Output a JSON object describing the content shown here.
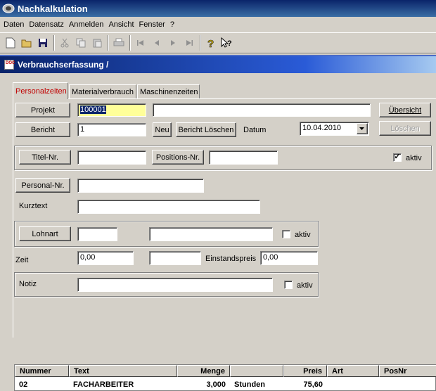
{
  "window": {
    "title": "Nachkalkulation"
  },
  "menu": {
    "items": [
      "Daten",
      "Datensatz",
      "Anmelden",
      "Ansicht",
      "Fenster",
      "?"
    ]
  },
  "child": {
    "title": "Verbrauchserfassung /"
  },
  "tabs": [
    "Personalzeiten",
    "Materialverbrauch",
    "Maschinenzeiten"
  ],
  "form": {
    "projekt_label": "Projekt",
    "projekt_value": "100001",
    "projekt_name": "",
    "uebersicht_label": "Übersicht",
    "bericht_label": "Bericht",
    "bericht_value": "1",
    "neu_label": "Neu",
    "bericht_loeschen_label": "Bericht Löschen",
    "datum_label": "Datum",
    "datum_value": "10.04.2010",
    "loeschen_label": "Löschen",
    "titel_label": "Titel-Nr.",
    "titel_value": "",
    "positions_label": "Positions-Nr.",
    "positions_value": "",
    "aktiv_label": "aktiv",
    "aktiv1_checked": "✓",
    "personal_label": "Personal-Nr.",
    "personal_value": "",
    "kurztext_label": "Kurztext",
    "kurztext_value": "",
    "lohnart_label": "Lohnart",
    "lohnart_code": "",
    "lohnart_name": "",
    "aktiv2_checked": "",
    "zeit_label": "Zeit",
    "zeit_value": "0,00",
    "zeit_extra": "",
    "einstandspreis_label": "Einstandspreis",
    "einstandspreis_value": "0,00",
    "notiz_label": "Notiz",
    "notiz_value": "",
    "aktiv3_checked": ""
  },
  "table": {
    "columns": [
      "Nummer",
      "Text",
      "Menge",
      "",
      "Preis",
      "Art",
      "PosNr"
    ],
    "rows": [
      {
        "nummer": "02",
        "text": "FACHARBEITER",
        "menge": "3,000",
        "einheit": "Stunden",
        "preis": "75,60",
        "art": "",
        "posnr": ""
      }
    ]
  }
}
